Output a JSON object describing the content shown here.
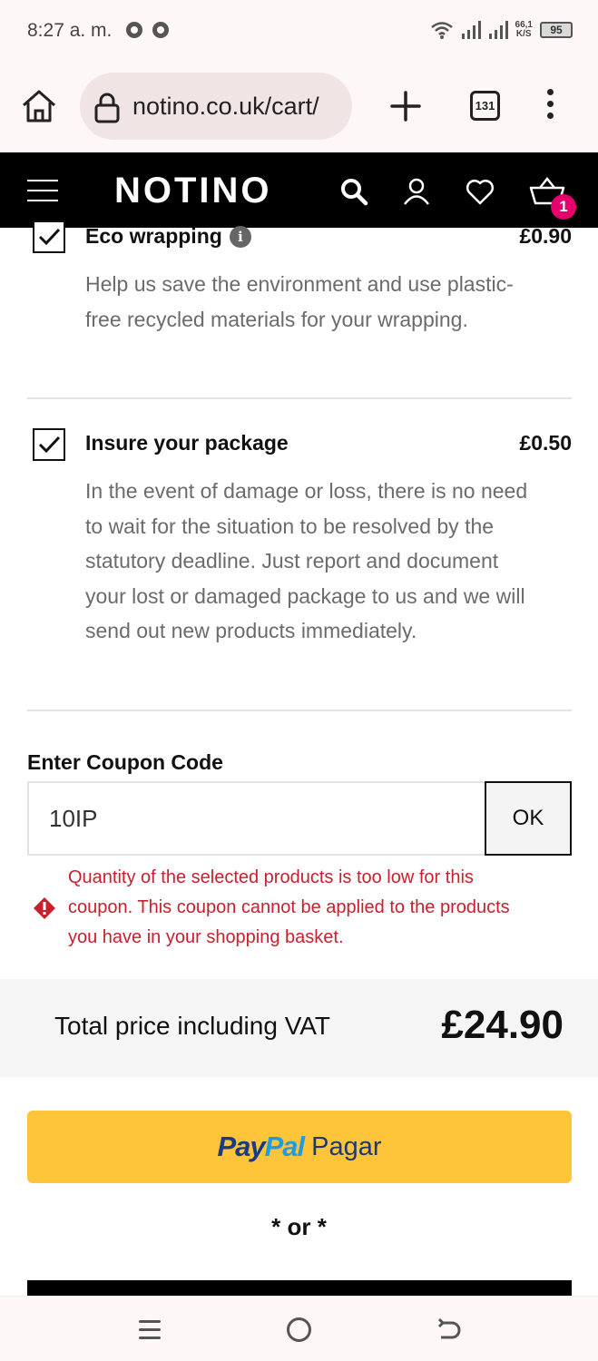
{
  "status_bar": {
    "time": "8:27 a. m.",
    "speed_value": "66,1",
    "speed_unit": "K/S",
    "battery": "95"
  },
  "browser": {
    "url": "notino.co.uk/cart/",
    "tab_count": "131"
  },
  "site": {
    "logo": "NOTINO",
    "cart_count": "1"
  },
  "options": [
    {
      "title": "Eco wrapping",
      "price": "£0.90",
      "checked": true,
      "description": "Help us save the environment and use plastic-free recycled materials for your wrapping."
    },
    {
      "title": "Insure your package",
      "price": "£0.50",
      "checked": true,
      "description": "In the event of damage or loss, there is no need to wait for the situation to be resolved by the statutory deadline. Just report and document your lost or damaged package to us and we will send out new products immediately."
    }
  ],
  "coupon": {
    "label": "Enter Coupon Code",
    "value": "10IP",
    "button": "OK",
    "error": "Quantity of the selected products is too low for this coupon. This coupon cannot be applied to the products you have in your shopping basket."
  },
  "total": {
    "label": "Total price including VAT",
    "value": "£24.90"
  },
  "paypal": {
    "brand_pay": "Pay",
    "brand_pal": "Pal",
    "label": "Pagar"
  },
  "or_text": "* or *",
  "colors": {
    "accent_pink": "#e5006d",
    "error_red": "#c8202e",
    "paypal_yellow": "#fec43a",
    "paypal_navy": "#1a3a86",
    "paypal_blue": "#1e9be2"
  }
}
